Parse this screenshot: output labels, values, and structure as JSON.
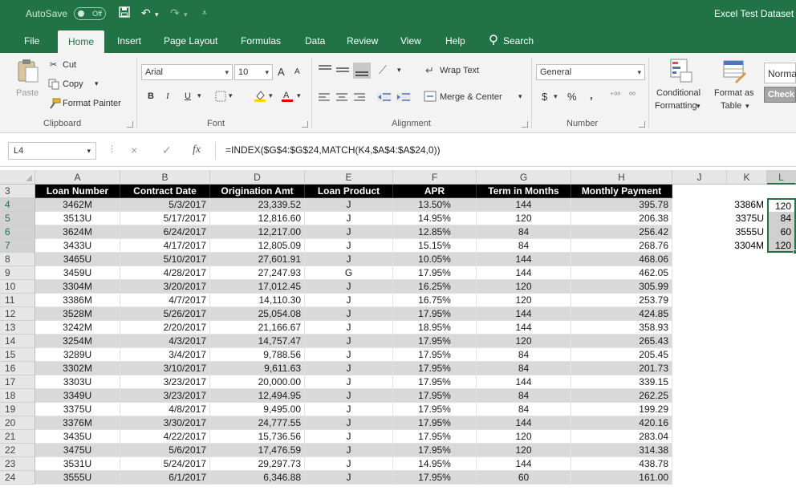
{
  "titlebar": {
    "autosave_label": "AutoSave",
    "autosave_state": "Off",
    "file_title": "Excel Test Dataset"
  },
  "tabs": [
    "File",
    "Home",
    "Insert",
    "Page Layout",
    "Formulas",
    "Data",
    "Review",
    "View",
    "Help",
    "Search"
  ],
  "ribbon": {
    "clipboard": {
      "paste": "Paste",
      "cut": "Cut",
      "copy": "Copy",
      "format_painter": "Format Painter",
      "label": "Clipboard"
    },
    "font": {
      "name": "Arial",
      "size": "10",
      "bold": "B",
      "italic": "I",
      "underline": "U",
      "grow": "A",
      "shrink": "A",
      "label": "Font"
    },
    "alignment": {
      "wrap_text": "Wrap Text",
      "merge_center": "Merge & Center",
      "label": "Alignment"
    },
    "number": {
      "format": "General",
      "currency": "$",
      "percent": "%",
      "comma": ",",
      "label": "Number"
    },
    "styles": {
      "conditional_line1": "Conditional",
      "conditional_line2": "Formatting",
      "format_table_line1": "Format as",
      "format_table_line2": "Table",
      "normal": "Norma",
      "check": "Check"
    }
  },
  "formula_bar": {
    "name_box": "L4",
    "cancel": "×",
    "enter": "✓",
    "fx": "fx",
    "formula": "=INDEX($G$4:$G$24,MATCH(K4,$A$4:$A$24,0))"
  },
  "columns": [
    "A",
    "B",
    "D",
    "E",
    "F",
    "G",
    "H",
    "J",
    "K",
    "L"
  ],
  "rows": [
    "3",
    "4",
    "5",
    "6",
    "7",
    "8",
    "9",
    "10",
    "11",
    "12",
    "13",
    "14",
    "15",
    "16",
    "17",
    "18",
    "19",
    "20",
    "21",
    "22",
    "23",
    "24"
  ],
  "table_headers": [
    "Loan Number",
    "Contract Date",
    "Origination Amt",
    "Loan Product",
    "APR",
    "Term in Months",
    "Monthly Payment"
  ],
  "table_rows": [
    [
      "3462M",
      "5/3/2017",
      "23,339.52",
      "J",
      "13.50%",
      "144",
      "395.78"
    ],
    [
      "3513U",
      "5/17/2017",
      "12,816.60",
      "J",
      "14.95%",
      "120",
      "206.38"
    ],
    [
      "3624M",
      "6/24/2017",
      "12,217.00",
      "J",
      "12.85%",
      "84",
      "256.42"
    ],
    [
      "3433U",
      "4/17/2017",
      "12,805.09",
      "J",
      "15.15%",
      "84",
      "268.76"
    ],
    [
      "3465U",
      "5/10/2017",
      "27,601.91",
      "J",
      "10.05%",
      "144",
      "468.06"
    ],
    [
      "3459U",
      "4/28/2017",
      "27,247.93",
      "G",
      "17.95%",
      "144",
      "462.05"
    ],
    [
      "3304M",
      "3/20/2017",
      "17,012.45",
      "J",
      "16.25%",
      "120",
      "305.99"
    ],
    [
      "3386M",
      "4/7/2017",
      "14,110.30",
      "J",
      "16.75%",
      "120",
      "253.79"
    ],
    [
      "3528M",
      "5/26/2017",
      "25,054.08",
      "J",
      "17.95%",
      "144",
      "424.85"
    ],
    [
      "3242M",
      "2/20/2017",
      "21,166.67",
      "J",
      "18.95%",
      "144",
      "358.93"
    ],
    [
      "3254M",
      "4/3/2017",
      "14,757.47",
      "J",
      "17.95%",
      "120",
      "265.43"
    ],
    [
      "3289U",
      "3/4/2017",
      "9,788.56",
      "J",
      "17.95%",
      "84",
      "205.45"
    ],
    [
      "3302M",
      "3/10/2017",
      "9,611.63",
      "J",
      "17.95%",
      "84",
      "201.73"
    ],
    [
      "3303U",
      "3/23/2017",
      "20,000.00",
      "J",
      "17.95%",
      "144",
      "339.15"
    ],
    [
      "3349U",
      "3/23/2017",
      "12,494.95",
      "J",
      "17.95%",
      "84",
      "262.25"
    ],
    [
      "3375U",
      "4/8/2017",
      "9,495.00",
      "J",
      "17.95%",
      "84",
      "199.29"
    ],
    [
      "3376M",
      "3/30/2017",
      "24,777.55",
      "J",
      "17.95%",
      "144",
      "420.16"
    ],
    [
      "3435U",
      "4/22/2017",
      "15,736.56",
      "J",
      "17.95%",
      "120",
      "283.04"
    ],
    [
      "3475U",
      "5/6/2017",
      "17,476.59",
      "J",
      "17.95%",
      "120",
      "314.38"
    ],
    [
      "3531U",
      "5/24/2017",
      "29,297.73",
      "J",
      "14.95%",
      "144",
      "438.78"
    ],
    [
      "3555U",
      "6/1/2017",
      "6,346.88",
      "J",
      "17.95%",
      "60",
      "161.00"
    ]
  ],
  "lookup_rows": [
    {
      "key": "3386M",
      "term": "120"
    },
    {
      "key": "3375U",
      "term": "84"
    },
    {
      "key": "3555U",
      "term": "60"
    },
    {
      "key": "3304M",
      "term": "120"
    }
  ],
  "colors": {
    "excel_green": "#217346",
    "band_gray": "#d9d9d9",
    "header_black": "#000000"
  }
}
